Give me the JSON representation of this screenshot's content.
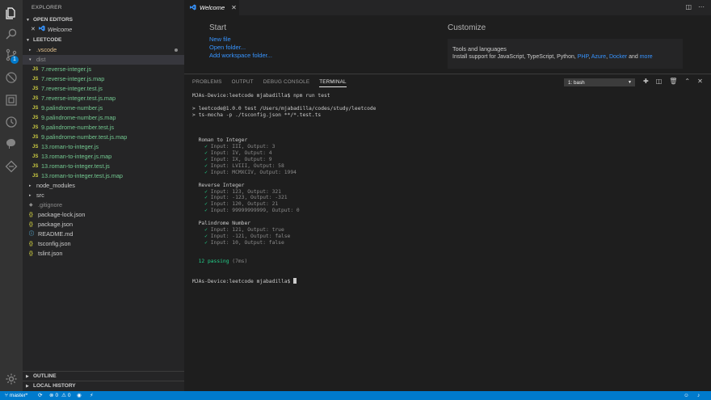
{
  "activity_bar": {
    "scm_badge": "1"
  },
  "sidebar": {
    "title": "EXPLORER",
    "open_editors": {
      "header": "OPEN EDITORS",
      "items": [
        {
          "close": "✕",
          "label": "Welcome"
        }
      ]
    },
    "project": {
      "header": "LEETCODE",
      "rows": [
        {
          "label": ".vscode",
          "kind": "folder",
          "indent": 1,
          "twisty": "▸",
          "modified": true
        },
        {
          "label": "dist",
          "kind": "folder",
          "indent": 1,
          "twisty": "▾",
          "selected": true
        },
        {
          "label": "7.reverse-integer.js",
          "kind": "js",
          "icon": "JS",
          "indent": 2
        },
        {
          "label": "7.reverse-integer.js.map",
          "kind": "js",
          "icon": "JS",
          "indent": 2
        },
        {
          "label": "7.reverse-integer.test.js",
          "kind": "js",
          "icon": "JS",
          "indent": 2
        },
        {
          "label": "7.reverse-integer.test.js.map",
          "kind": "js",
          "icon": "JS",
          "indent": 2
        },
        {
          "label": "9.palindrome-number.js",
          "kind": "js",
          "icon": "JS",
          "indent": 2
        },
        {
          "label": "9.palindrome-number.js.map",
          "kind": "js",
          "icon": "JS",
          "indent": 2
        },
        {
          "label": "9.palindrome-number.test.js",
          "kind": "js",
          "icon": "JS",
          "indent": 2
        },
        {
          "label": "9.palindrome-number.test.js.map",
          "kind": "js",
          "icon": "JS",
          "indent": 2
        },
        {
          "label": "13.roman-to-integer.js",
          "kind": "js",
          "icon": "JS",
          "indent": 2
        },
        {
          "label": "13.roman-to-integer.js.map",
          "kind": "js",
          "icon": "JS",
          "indent": 2
        },
        {
          "label": "13.roman-to-integer.test.js",
          "kind": "js",
          "icon": "JS",
          "indent": 2
        },
        {
          "label": "13.roman-to-integer.test.js.map",
          "kind": "js",
          "icon": "JS",
          "indent": 2
        },
        {
          "label": "node_modules",
          "kind": "folder",
          "indent": 1,
          "twisty": "▸"
        },
        {
          "label": "src",
          "kind": "folder",
          "indent": 1,
          "twisty": "▸"
        },
        {
          "label": ".gitignore",
          "kind": "git",
          "icon": "◆",
          "indent": 1
        },
        {
          "label": "package-lock.json",
          "kind": "json",
          "icon": "{}",
          "indent": 1
        },
        {
          "label": "package.json",
          "kind": "json",
          "icon": "{}",
          "indent": 1
        },
        {
          "label": "README.md",
          "kind": "md",
          "icon": "ⓘ",
          "indent": 1
        },
        {
          "label": "tsconfig.json",
          "kind": "json",
          "icon": "{}",
          "indent": 1
        },
        {
          "label": "tslint.json",
          "kind": "json",
          "icon": "{}",
          "indent": 1
        }
      ]
    },
    "outline": "OUTLINE",
    "local_history": "LOCAL HISTORY"
  },
  "tabs": [
    {
      "label": "Welcome",
      "close": "✕"
    }
  ],
  "welcome": {
    "start_heading": "Start",
    "links": [
      "New file",
      "Open folder...",
      "Add workspace folder..."
    ],
    "customize_heading": "Customize",
    "tools_title": "Tools and languages",
    "tools_prefix": "Install support for ",
    "tools_langs": [
      "JavaScript",
      "TypeScript",
      "Python",
      "PHP",
      "Azure",
      "Docker"
    ],
    "tools_and": " and ",
    "tools_more": "more"
  },
  "panel": {
    "tabs": [
      "PROBLEMS",
      "OUTPUT",
      "DEBUG CONSOLE",
      "TERMINAL"
    ],
    "active_tab": "TERMINAL",
    "terminal_select": "1: bash",
    "terminal_lines": [
      {
        "text": "MJAs-Device:leetcode mjabadilla$ npm run test",
        "style": ""
      },
      {
        "text": "",
        "style": ""
      },
      {
        "text": "> leetcode@1.0.0 test /Users/mjabadilla/codes/study/leetcode",
        "style": ""
      },
      {
        "text": "> ts-mocha -p ./tsconfig.json **/*.test.ts",
        "style": ""
      },
      {
        "text": "",
        "style": ""
      },
      {
        "text": "",
        "style": ""
      },
      {
        "text": "",
        "style": ""
      },
      {
        "text": "  Roman to Integer",
        "style": ""
      },
      {
        "text": "    ✓ Input: III, Output: 3",
        "style": "gray"
      },
      {
        "text": "    ✓ Input: IV, Output: 4",
        "style": "gray"
      },
      {
        "text": "    ✓ Input: IX, Output: 9",
        "style": "gray"
      },
      {
        "text": "    ✓ Input: LVIII, Output: 58",
        "style": "gray"
      },
      {
        "text": "    ✓ Input: MCMXCIV, Output: 1994",
        "style": "gray"
      },
      {
        "text": "",
        "style": ""
      },
      {
        "text": "  Reverse Integer",
        "style": ""
      },
      {
        "text": "    ✓ Input: 123, Output: 321",
        "style": "gray"
      },
      {
        "text": "    ✓ Input: -123, Output: -321",
        "style": "gray"
      },
      {
        "text": "    ✓ Input: 120, Output: 21",
        "style": "gray"
      },
      {
        "text": "    ✓ Input: 99999999999, Output: 0",
        "style": "gray"
      },
      {
        "text": "",
        "style": ""
      },
      {
        "text": "  Palindrome Number",
        "style": ""
      },
      {
        "text": "    ✓ Input: 121, Output: true",
        "style": "gray"
      },
      {
        "text": "    ✓ Input: -121, Output: false",
        "style": "gray"
      },
      {
        "text": "    ✓ Input: 10, Output: false",
        "style": "gray"
      },
      {
        "text": "",
        "style": ""
      },
      {
        "text": "",
        "style": ""
      },
      {
        "text": "  12 passing",
        "style": "green",
        "suffix": " (7ms)"
      },
      {
        "text": "",
        "style": ""
      },
      {
        "text": "",
        "style": ""
      },
      {
        "text": "MJAs-Device:leetcode mjabadilla$ ",
        "style": "",
        "cursor": true
      }
    ]
  },
  "status": {
    "branch": "master*",
    "sync": "⟳",
    "errors": "0",
    "warnings": "0",
    "lightning": "⚡"
  },
  "colors": {
    "accent": "#007acc",
    "link": "#3794ff",
    "pass": "#23d18b"
  }
}
